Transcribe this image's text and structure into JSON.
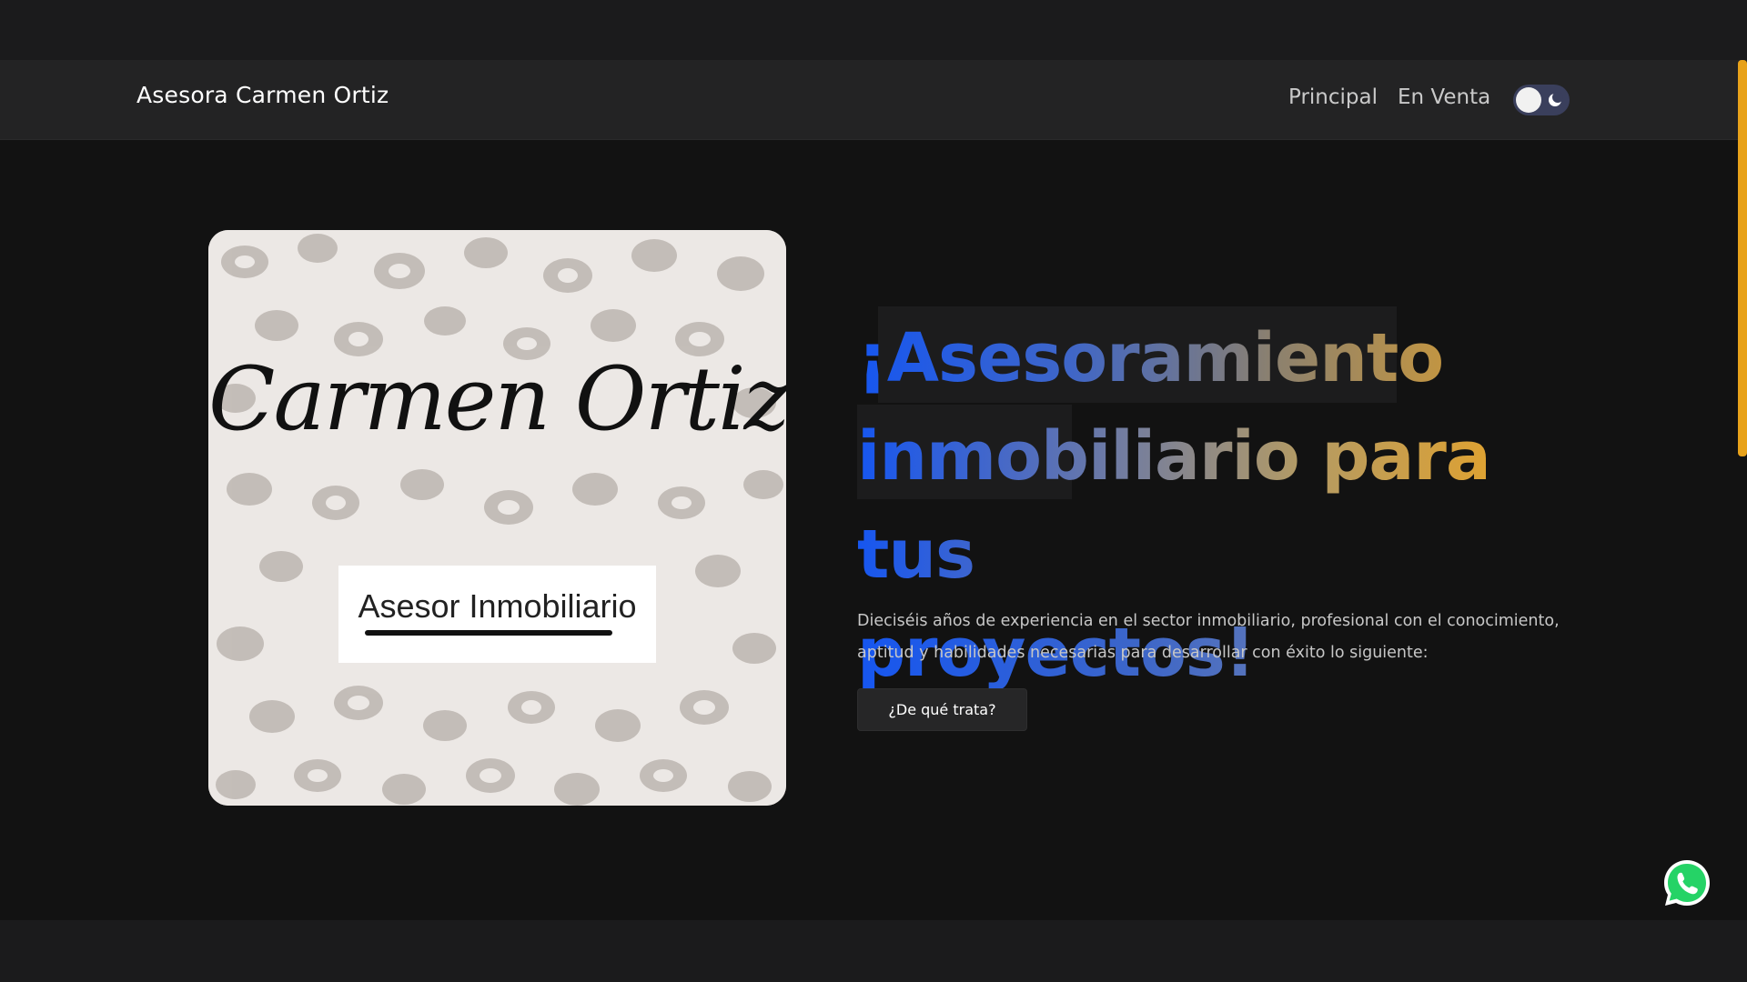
{
  "navbar": {
    "brand": "Asesora Carmen Ortiz",
    "links": [
      "Principal",
      "En Venta"
    ],
    "theme_toggle": {
      "state": "dark",
      "icon": "moon-icon"
    }
  },
  "hero": {
    "logo": {
      "script_name": "Carmen Ortiz",
      "subtitle": "Asesor Inmobiliario"
    },
    "headline": {
      "line1": "¡Asesoramiento",
      "line2": "inmobiliario para tus",
      "line3": "proyectos!"
    },
    "description": "Dieciséis años de experiencia en el sector inmobiliario, profesional con el conocimiento, aptitud y habilidades necesarias para desarrollar con éxito lo siguiente:",
    "cta_label": "¿De qué trata?"
  },
  "floating": {
    "icon": "whatsapp-icon"
  },
  "colors": {
    "accent_blue": "#1656f0",
    "accent_gold": "#e9a422",
    "scrollbar": "#e8a21a",
    "background": "#121212"
  }
}
